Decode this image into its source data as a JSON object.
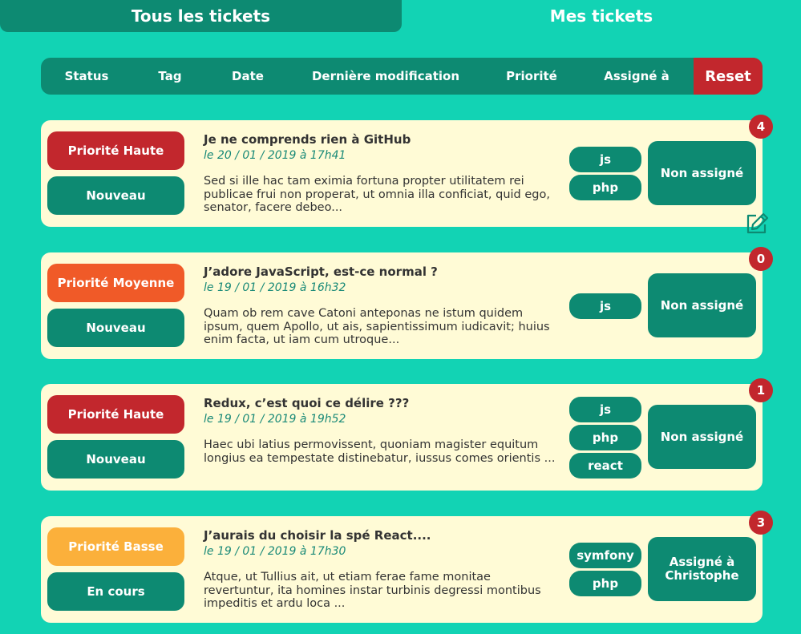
{
  "tabs": {
    "all": "Tous les tickets",
    "mine": "Mes tickets"
  },
  "filters": [
    "Status",
    "Tag",
    "Date",
    "Dernière modification",
    "Priorité",
    "Assigné à"
  ],
  "reset_label": "Reset",
  "colors": {
    "background": "#12d3b4",
    "primary": "#0d8a72",
    "card": "#fffbd6",
    "priority_high": "#c2272d",
    "priority_medium": "#f05a28",
    "priority_low": "#fbb03b",
    "badge": "#c2272d"
  },
  "edit_icon": "edit-icon",
  "tickets": [
    {
      "priority": "Priorité Haute",
      "status": "Nouveau",
      "title": "Je ne comprends rien à GitHub",
      "date": "le 20 / 01 / 2019 à 17h41",
      "description": "Sed si ille hac tam eximia fortuna propter utilitatem rei publicae frui non properat, ut omnia illa conficiat, quid ego, senator, facere debeo...",
      "tags": [
        "js",
        "php"
      ],
      "assignee": "Non assigné",
      "count": "4"
    },
    {
      "priority": "Priorité Moyenne",
      "status": "Nouveau",
      "title": "J’adore JavaScript, est-ce normal ?",
      "date": "le 19 / 01 / 2019 à 16h32",
      "description": "Quam ob rem cave Catoni anteponas ne istum quidem ipsum, quem Apollo, ut ais, sapientissimum iudicavit; huius enim facta, ut iam cum utroque...",
      "tags": [
        "js"
      ],
      "assignee": "Non assigné",
      "count": "0"
    },
    {
      "priority": "Priorité Haute",
      "status": "Nouveau",
      "title": "Redux, c’est quoi ce délire ???",
      "date": "le 19 / 01 / 2019 à 19h52",
      "description": "Haec ubi latius permovissent, quoniam magister equitum longius ea tempestate distinebatur, iussus comes orientis ...",
      "tags": [
        "js",
        "php",
        "react"
      ],
      "assignee": "Non assigné",
      "count": "1"
    },
    {
      "priority": "Priorité Basse",
      "status": "En cours",
      "title": "J’aurais du choisir la spé React....",
      "date": "le 19 / 01 / 2019 à 17h30",
      "description": "Atque, ut Tullius ait, ut etiam ferae fame monitae revertuntur, ita homines instar turbinis degressi montibus impeditis et ardu loca ...",
      "tags": [
        "symfony",
        "php"
      ],
      "assignee": "Assigné à Christophe",
      "count": "3"
    }
  ]
}
